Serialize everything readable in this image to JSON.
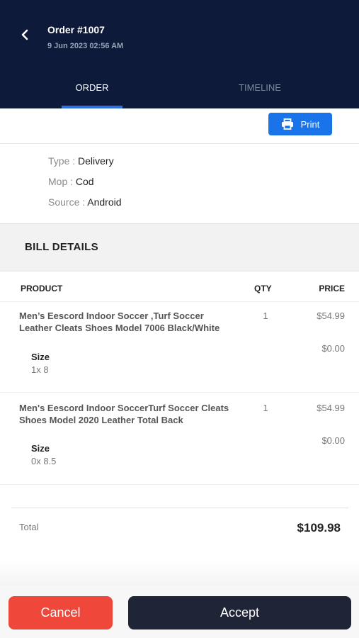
{
  "header": {
    "back_icon": "chevron-left-icon",
    "order_title": "Order #1007",
    "order_date": "9 Jun 2023 02:56 AM",
    "tabs": [
      {
        "label": "ORDER",
        "active": true
      },
      {
        "label": "TIMELINE",
        "active": false
      }
    ]
  },
  "toolbar": {
    "print_label": "Print",
    "print_icon": "printer-icon"
  },
  "order_meta": [
    {
      "label": "Type :",
      "value": "Delivery"
    },
    {
      "label": "Mop :",
      "value": "Cod"
    },
    {
      "label": "Source :",
      "value": "Android"
    }
  ],
  "bill": {
    "title": "BILL DETAILS",
    "columns": {
      "product": "PRODUCT",
      "qty": "QTY",
      "price": "PRICE"
    },
    "items": [
      {
        "name": "Men’s Eescord Indoor Soccer ,Turf Soccer Leather Cleats Shoes Model 7006 Black/White",
        "size_label": "Size",
        "size_value": "1x 8",
        "qty": "1",
        "price": "$54.99",
        "extra_price": "$0.00"
      },
      {
        "name": "Men's Eescord Indoor SoccerTurf Soccer Cleats Shoes Model 2020 Leather Total Back",
        "size_label": "Size",
        "size_value": "0x 8.5",
        "qty": "1",
        "price": "$54.99",
        "extra_price": "$0.00"
      }
    ],
    "total_label": "Total",
    "total_value": "$109.98"
  },
  "footer": {
    "cancel_label": "Cancel",
    "accept_label": "Accept"
  },
  "colors": {
    "header_bg": "#0d1a3a",
    "tab_accent": "#2d6fe0",
    "print_bg": "#1a73e8",
    "cancel_bg": "#f0473b",
    "accept_bg": "#1f2536"
  }
}
